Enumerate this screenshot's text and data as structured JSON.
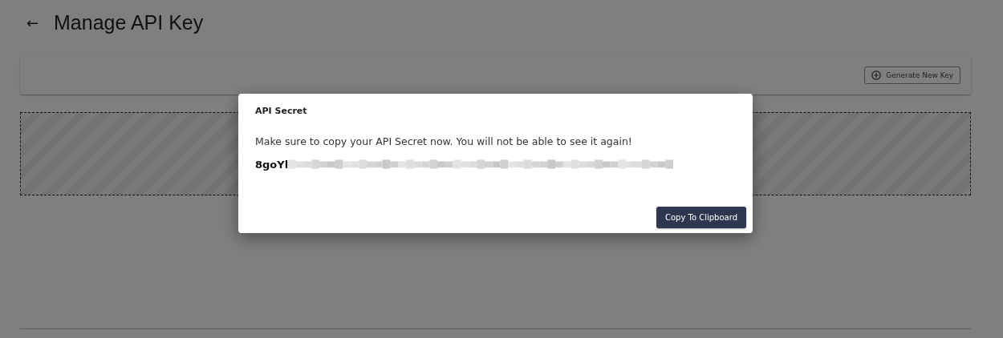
{
  "page": {
    "back": "←",
    "title": "Manage API Key"
  },
  "toolbar": {
    "button": "Generate New Key"
  },
  "dialog": {
    "title": "API Secret",
    "message": "Make sure to copy your API Secret now. You will not be able to see it again!",
    "secret": "8goYl",
    "button": "Copy To Clipboard"
  }
}
